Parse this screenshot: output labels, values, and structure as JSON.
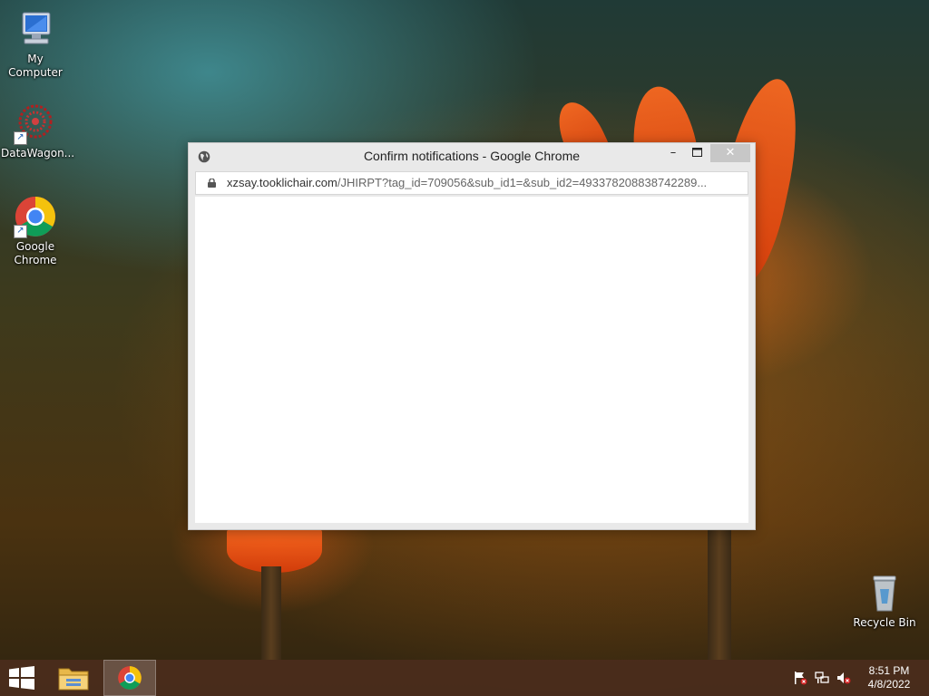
{
  "desktop": {
    "icons": [
      {
        "label": "My Computer"
      },
      {
        "label": "DataWagon..."
      },
      {
        "label": "Google Chrome"
      },
      {
        "label": "Recycle Bin"
      }
    ]
  },
  "window": {
    "title": "Confirm notifications - Google Chrome",
    "url_host": "xzsay.tooklichair.com",
    "url_path": "/JHIRPT?tag_id=709056&sub_id1=&sub_id2=493378208838742289...",
    "minimize_label": "–",
    "close_label": "✕"
  },
  "taskbar": {
    "time": "8:51 PM",
    "date": "4/8/2022"
  },
  "colors": {
    "taskbar": "#4b2d1c",
    "close_button": "#c7c7c7",
    "chrome_red": "#db4437",
    "chrome_yellow": "#f4c20d",
    "chrome_green": "#0f9d58",
    "chrome_blue": "#4285f4"
  }
}
